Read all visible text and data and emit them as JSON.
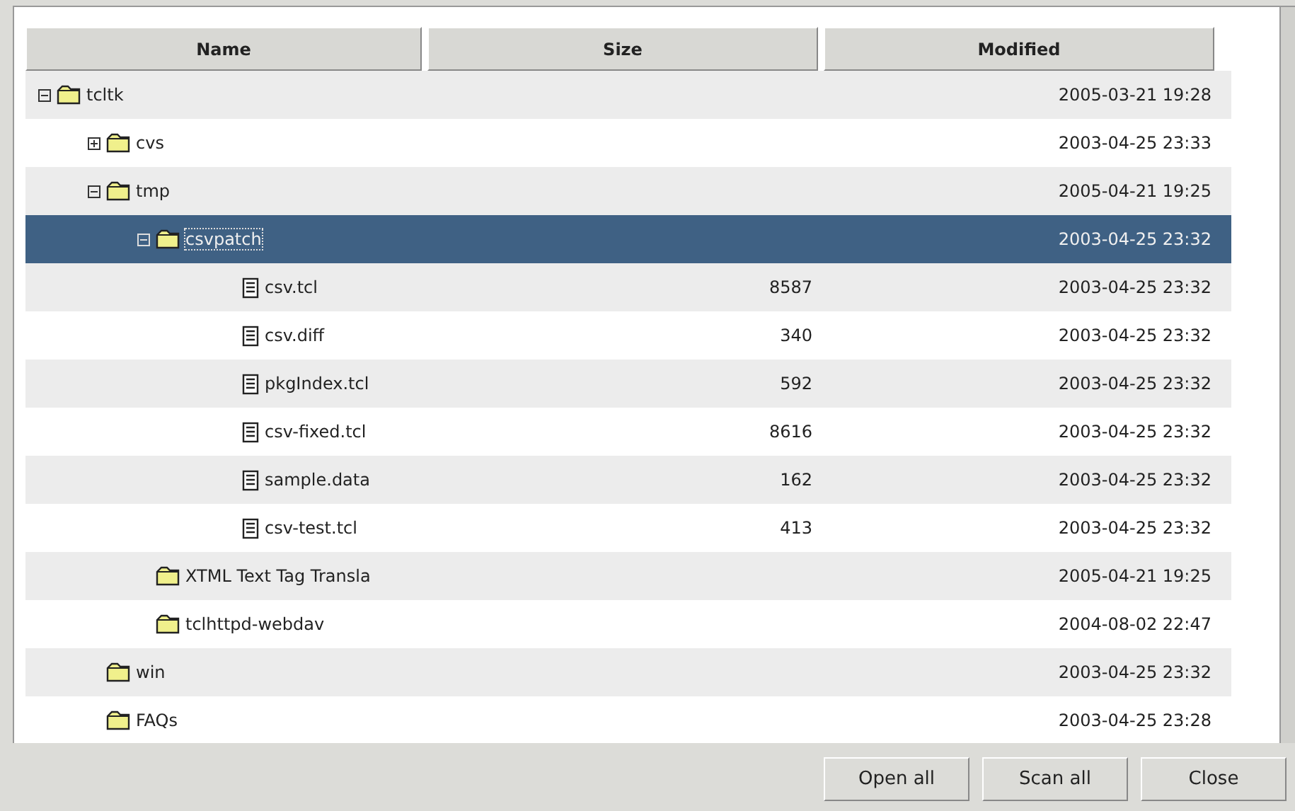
{
  "table": {
    "columns": [
      "Name",
      "Size",
      "Modified"
    ],
    "rows": [
      {
        "name": "tcltk",
        "kind": "folder",
        "expanded": true,
        "modified": "2005-03-21 19:28",
        "selected": false,
        "children": [
          {
            "name": "cvs",
            "kind": "folder",
            "expanded": false,
            "modified": "2003-04-25 23:33",
            "selected": false
          },
          {
            "name": "tmp",
            "kind": "folder",
            "expanded": true,
            "modified": "2005-04-21 19:25",
            "selected": false,
            "children": [
              {
                "name": "csvpatch",
                "kind": "folder",
                "expanded": true,
                "modified": "2003-04-25 23:32",
                "selected": true,
                "children": [
                  {
                    "name": "csv.tcl",
                    "kind": "file",
                    "size": "8587",
                    "modified": "2003-04-25 23:32",
                    "selected": false
                  },
                  {
                    "name": "csv.diff",
                    "kind": "file",
                    "size": "340",
                    "modified": "2003-04-25 23:32",
                    "selected": false
                  },
                  {
                    "name": "pkgIndex.tcl",
                    "kind": "file",
                    "size": "592",
                    "modified": "2003-04-25 23:32",
                    "selected": false
                  },
                  {
                    "name": "csv-fixed.tcl",
                    "kind": "file",
                    "size": "8616",
                    "modified": "2003-04-25 23:32",
                    "selected": false
                  },
                  {
                    "name": "sample.data",
                    "kind": "file",
                    "size": "162",
                    "modified": "2003-04-25 23:32",
                    "selected": false
                  },
                  {
                    "name": "csv-test.tcl",
                    "kind": "file",
                    "size": "413",
                    "modified": "2003-04-25 23:32",
                    "selected": false
                  }
                ]
              },
              {
                "name": "XTML Text Tag Transla",
                "kind": "folder",
                "modified": "2005-04-21 19:25",
                "selected": false
              },
              {
                "name": "tclhttpd-webdav",
                "kind": "folder",
                "modified": "2004-08-02 22:47",
                "selected": false
              }
            ]
          },
          {
            "name": "win",
            "kind": "folder",
            "modified": "2003-04-25 23:32",
            "selected": false
          },
          {
            "name": "FAQs",
            "kind": "folder",
            "modified": "2003-04-25 23:28",
            "selected": false
          }
        ]
      }
    ]
  },
  "buttons": [
    "Open all",
    "Scan all",
    "Close"
  ]
}
